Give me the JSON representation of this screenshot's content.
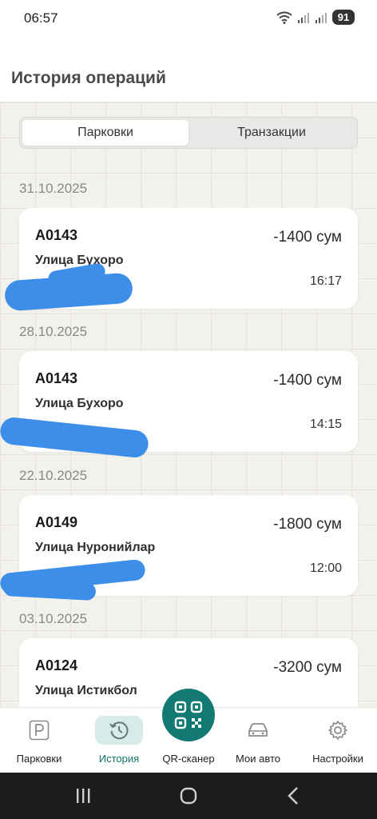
{
  "status": {
    "time": "06:57",
    "battery": "91"
  },
  "header": {
    "title": "История операций"
  },
  "tabs": [
    {
      "label": "Парковки",
      "active": true
    },
    {
      "label": "Транзакции",
      "active": false
    }
  ],
  "groups": [
    {
      "date": "31.10.2025",
      "plate": "A0143",
      "amount": "-1400 сум",
      "street": "Улица Бухоро",
      "time": "16:17"
    },
    {
      "date": "28.10.2025",
      "plate": "A0143",
      "amount": "-1400 сум",
      "street": "Улица Бухоро",
      "time": "14:15"
    },
    {
      "date": "22.10.2025",
      "plate": "A0149",
      "amount": "-1800 сум",
      "street": "Улица Нуронийлар",
      "time": "12:00"
    },
    {
      "date": "03.10.2025",
      "plate": "A0124",
      "amount": "-3200 сум",
      "street": "Улица Истикбол",
      "time": ""
    }
  ],
  "nav": [
    {
      "label": "Парковки",
      "icon": "parking-icon"
    },
    {
      "label": "История",
      "icon": "history-icon",
      "active": true
    },
    {
      "label": "QR-сканер",
      "icon": "qr-icon"
    },
    {
      "label": "Мои авто",
      "icon": "car-icon"
    },
    {
      "label": "Настройки",
      "icon": "gear-icon"
    }
  ],
  "colors": {
    "accent": "#127a72",
    "active_bg": "#d7ebe8",
    "scribble": "#3d8ee8"
  }
}
